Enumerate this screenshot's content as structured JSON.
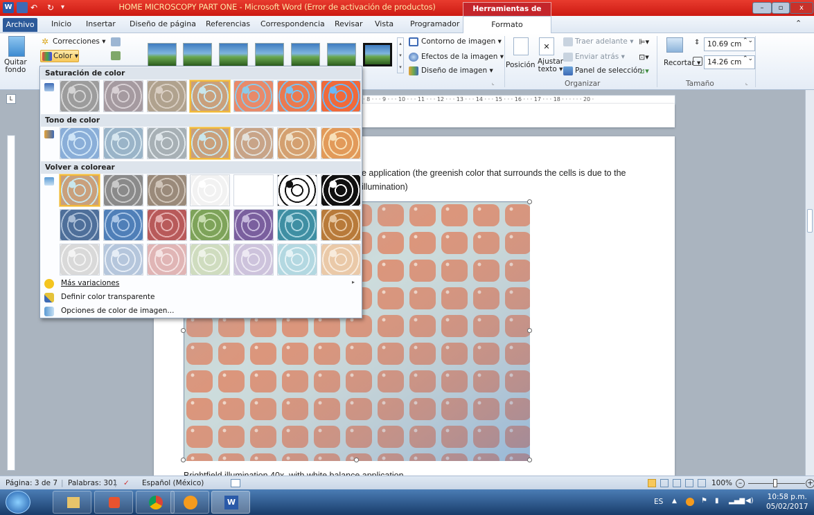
{
  "titlebar": {
    "title": "HOME MICROSCOPY PART ONE  -  Microsoft Word (Error de activación de productos)",
    "context_tab": "Herramientas de imagen",
    "buttons": {
      "minimize": "–",
      "restore": "▫",
      "close": "x"
    }
  },
  "tabs": {
    "file": "Archivo",
    "items": [
      "Inicio",
      "Insertar",
      "Diseño de página",
      "Referencias",
      "Correspondencia",
      "Revisar",
      "Vista",
      "Programador"
    ],
    "active": "Formato"
  },
  "ribbon": {
    "remove_bg": [
      "Quitar",
      "fondo"
    ],
    "corrections": "Correcciones",
    "color": "Color",
    "border": "Contorno de imagen",
    "effects": "Efectos de la imagen",
    "layout": "Diseño de imagen",
    "position": "Posición",
    "wrap": [
      "Ajustar",
      "texto"
    ],
    "bring_forward": "Traer adelante",
    "send_back": "Enviar atrás",
    "selection_pane": "Panel de selección",
    "organize_group": "Organizar",
    "crop": "Recortar",
    "height": "10.69 cm",
    "width": "14.26 cm",
    "size_group": "Tamaño"
  },
  "colormenu": {
    "saturation_title": "Saturación de color",
    "tone_title": "Tono de color",
    "recolor_title": "Volver a colorear",
    "more_variations": "Más variaciones",
    "transparent": "Definir color transparente",
    "options": "Opciones de color de imagen..."
  },
  "document": {
    "ruler_text": "· 8 · · · 9 · · · 10 · · · 11 · · · 12 · · · 13 · · · 14 · · · 15 · · · 16 · · · 17 · · · 18 · · ·    · · · 20 ·",
    "caption_line1": "e application (the greenish color that surrounds the cells is due to the",
    "caption_line2": "illumination)",
    "caption_bottom": "Brightfield illumination 40x, with white balance application"
  },
  "statusbar": {
    "page": "Página: 3 de 7",
    "words": "Palabras: 301",
    "language": "Español (México)",
    "zoom": "100%"
  },
  "taskbar": {
    "lang": "ES",
    "time": "10:58 p.m.",
    "date": "05/02/2017"
  },
  "colors": {
    "titlebar": "#d42a1f",
    "selected_swatch": "#f0b83a",
    "file_tab": "#2c5a9a"
  }
}
